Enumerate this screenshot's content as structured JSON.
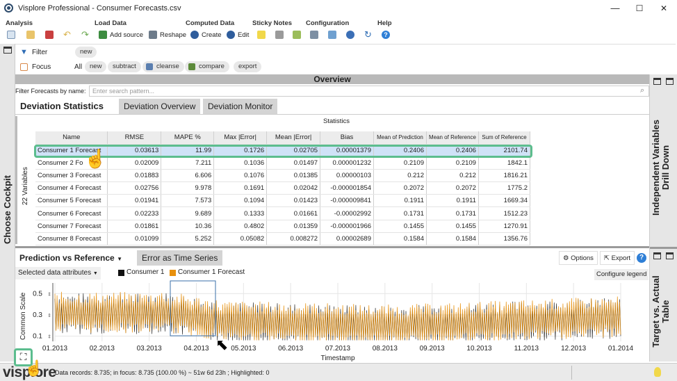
{
  "window": {
    "title": "Visplore Professional - Consumer Forecasts.csv",
    "minimize": "—",
    "maximize": "☐",
    "close": "✕"
  },
  "ribbon": {
    "groups": [
      "Analysis",
      "Load Data",
      "Computed Data",
      "Sticky Notes",
      "Configuration",
      "Help"
    ],
    "add_source": "Add source",
    "reshape": "Reshape",
    "create": "Create",
    "edit": "Edit"
  },
  "filter_bar": {
    "filter_label": "Filter",
    "filter_new": "new",
    "focus_label": "Focus",
    "focus_all": "All",
    "focus_new": "new",
    "subtract": "subtract",
    "cleanse": "cleanse",
    "compare": "compare",
    "export": "export"
  },
  "left_bar": {
    "label": "Choose Cockpit"
  },
  "right_bar": {
    "top_label": "Independent Variables Drill Down",
    "bottom_label": "Target vs. Actual Table"
  },
  "overview": {
    "title": "Overview"
  },
  "search": {
    "label": "Filter Forecasts by name:",
    "placeholder": "Enter search pattern..."
  },
  "top_tabs": [
    "Deviation Statistics",
    "Deviation Overview",
    "Deviation Monitor"
  ],
  "statistics": {
    "caption": "Statistics",
    "row_axis_label": "22 Variables",
    "columns": [
      "Name",
      "RMSE",
      "MAPE %",
      "Max |Error|",
      "Mean |Error|",
      "Bias",
      "Mean of Prediction",
      "Mean of Reference",
      "Sum of Reference"
    ],
    "rows": [
      [
        "Consumer 1 Forecast",
        "0.03613",
        "11.99",
        "0.1726",
        "0.02705",
        "0.00001379",
        "0.2406",
        "0.2406",
        "2101.74"
      ],
      [
        "Consumer 2 Fo",
        "0.02009",
        "7.211",
        "0.1036",
        "0.01497",
        "0.000001232",
        "0.2109",
        "0.2109",
        "1842.1"
      ],
      [
        "Consumer 3 Forecast",
        "0.01883",
        "6.606",
        "0.1076",
        "0.01385",
        "0.00000103",
        "0.212",
        "0.212",
        "1816.21"
      ],
      [
        "Consumer 4 Forecast",
        "0.02756",
        "9.978",
        "0.1691",
        "0.02042",
        "-0.000001854",
        "0.2072",
        "0.2072",
        "1775.2"
      ],
      [
        "Consumer 5 Forecast",
        "0.01941",
        "7.573",
        "0.1094",
        "0.01423",
        "-0.000009841",
        "0.1911",
        "0.1911",
        "1669.34"
      ],
      [
        "Consumer 6 Forecast",
        "0.02233",
        "9.689",
        "0.1333",
        "0.01661",
        "-0.00002992",
        "0.1731",
        "0.1731",
        "1512.23"
      ],
      [
        "Consumer 7 Forecast",
        "0.01861",
        "10.36",
        "0.4802",
        "0.01359",
        "-0.000001966",
        "0.1455",
        "0.1455",
        "1270.91"
      ],
      [
        "Consumer 8 Forecast",
        "0.01099",
        "5.252",
        "0.05082",
        "0.008272",
        "0.00002689",
        "0.1584",
        "0.1584",
        "1356.76"
      ]
    ]
  },
  "bottom_tabs": {
    "active": "Prediction vs Reference",
    "other": "Error as Time Series",
    "options": "Options",
    "export": "Export"
  },
  "chart_controls": {
    "attributes": "Selected data attributes",
    "configure_legend": "Configure legend"
  },
  "chart_data": {
    "type": "line",
    "ylabel": "Common Scale",
    "xlabel": "Timestamp",
    "yticks": [
      "0.5",
      "0.3",
      "0.1"
    ],
    "ylim": [
      0.05,
      0.6
    ],
    "xticks": [
      "01.2013",
      "02.2013",
      "03.2013",
      "04.2013",
      "05.2013",
      "06.2013",
      "07.2013",
      "08.2013",
      "09.2013",
      "10.2013",
      "11.2013",
      "12.2013",
      "01.2014"
    ],
    "series": [
      {
        "name": "Consumer 1",
        "color": "#111111"
      },
      {
        "name": "Consumer 1 Forecast",
        "color": "#e8900c"
      }
    ],
    "grid": true
  },
  "status": {
    "text": "Data records: 8.735; in focus: 8.735 (100.00 %) ~ 51w 6d 23h ; Highlighted: 0",
    "logo": "visplore"
  }
}
